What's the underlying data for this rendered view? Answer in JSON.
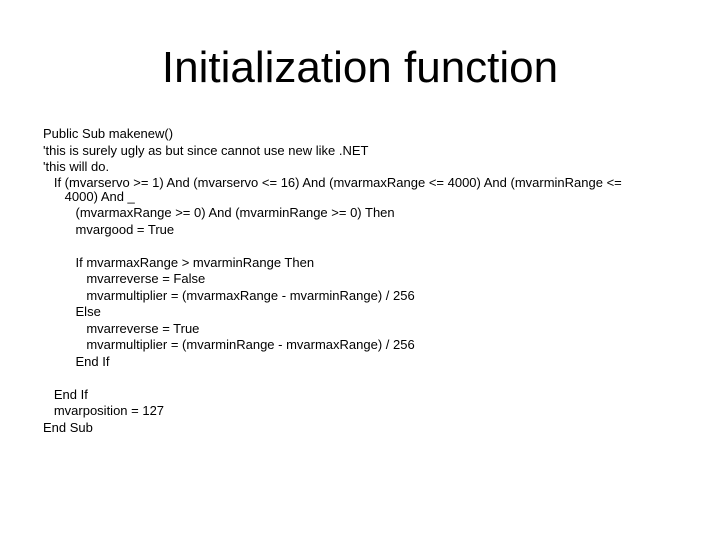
{
  "slide": {
    "title": "Initialization function",
    "code_lines": [
      "Public Sub makenew()",
      "'this is surely ugly as but since cannot use new like .NET",
      "'this will do.",
      "   If (mvarservo >= 1) And (mvarservo <= 16) And (mvarmaxRange <= 4000) And (mvarminRange <=",
      "      4000) And _",
      "         (mvarmaxRange >= 0) And (mvarminRange >= 0) Then",
      "         mvargood = True",
      "",
      "         If mvarmaxRange > mvarminRange Then",
      "            mvarreverse = False",
      "            mvarmultiplier = (mvarmaxRange - mvarminRange) / 256",
      "         Else",
      "            mvarreverse = True",
      "            mvarmultiplier = (mvarminRange - mvarmaxRange) / 256",
      "         End If",
      "",
      "   End If",
      "   mvarposition = 127",
      "End Sub"
    ]
  }
}
